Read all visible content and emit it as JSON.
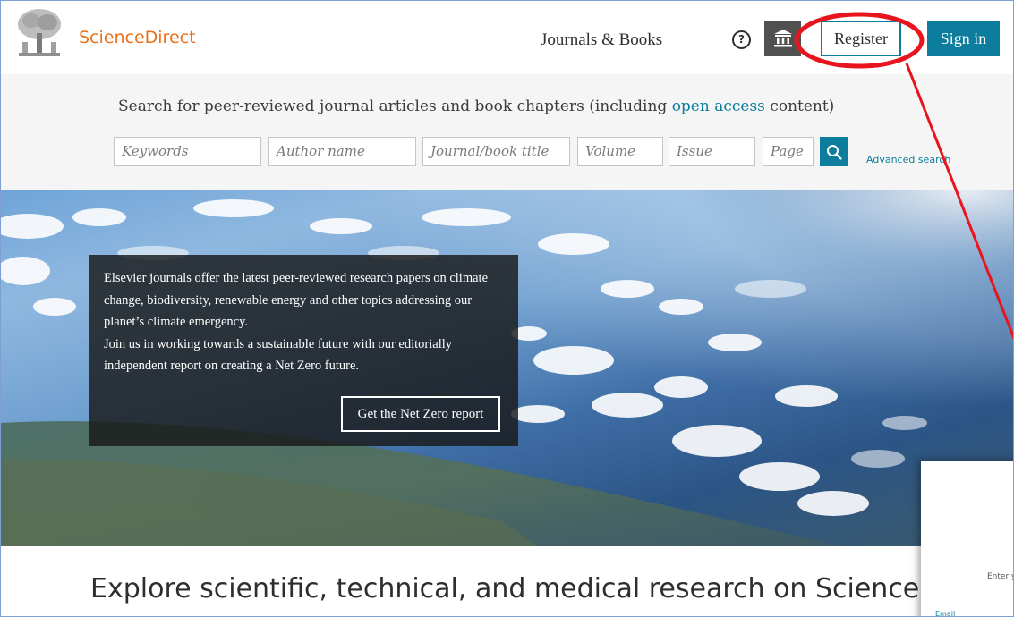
{
  "header": {
    "brand": "ScienceDirect",
    "nav_journals": "Journals & Books",
    "help_icon": "?",
    "register_label": "Register",
    "signin_label": "Sign in"
  },
  "search": {
    "intro_before": "Search for peer-reviewed journal articles and book chapters (including ",
    "intro_link": "open access",
    "intro_after": " content)",
    "fields": [
      {
        "placeholder": "Keywords"
      },
      {
        "placeholder": "Author name"
      },
      {
        "placeholder": "Journal/book title"
      },
      {
        "placeholder": "Volume"
      },
      {
        "placeholder": "Issue"
      },
      {
        "placeholder": "Page"
      }
    ],
    "advanced_label": "Advanced search"
  },
  "hero": {
    "text_line1": "Elsevier journals offer the latest peer-reviewed research papers on climate change, biodiversity, renewable energy and other topics addressing our planet’s climate emergency.",
    "text_line2": "Join us in working towards a sustainable future with our editorially independent report on creating a Net Zero future.",
    "button_label": "Get the Net Zero report"
  },
  "explore": {
    "heading": "Explore scientific, technical, and medical research on ScienceDir"
  },
  "side_panel": {
    "enter_text": "Enter y",
    "email_label": "Email"
  },
  "colors": {
    "brand_orange": "#e9711c",
    "accent_teal": "#0c7d9d",
    "annotation_red": "#e8141e"
  }
}
